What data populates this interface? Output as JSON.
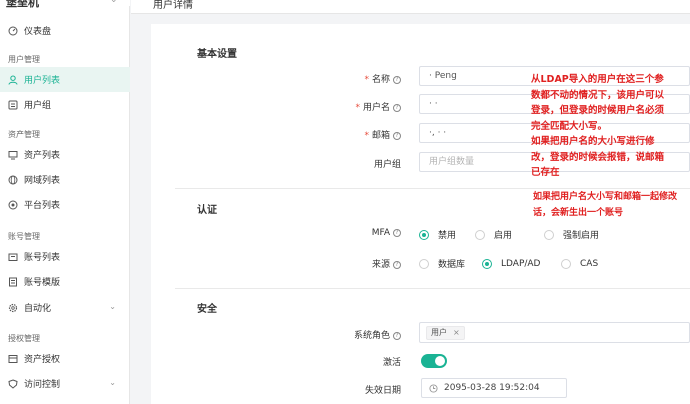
{
  "app": {
    "brand": "堡垒机",
    "page_title": "用户详情"
  },
  "sidebar": {
    "top_item": "仪表盘",
    "groups": [
      {
        "label": "用户管理",
        "items": [
          "用户列表",
          "用户组"
        ]
      },
      {
        "label": "资产管理",
        "items": [
          "资产列表",
          "网域列表",
          "平台列表"
        ]
      },
      {
        "label": "账号管理",
        "items": [
          "账号列表",
          "账号模版",
          "自动化"
        ]
      },
      {
        "label": "授权管理",
        "items": [
          "资产授权",
          "访问控制"
        ]
      }
    ],
    "active_item": "用户列表"
  },
  "form": {
    "basic": {
      "title": "基本设置",
      "name_label": "名称",
      "name_value": "· Peng",
      "username_label": "用户名",
      "username_value": "· ·",
      "email_label": "邮箱",
      "email_value": "·, ·    ·",
      "group_label": "用户组",
      "group_placeholder": "用户组数量"
    },
    "auth": {
      "title": "认证",
      "mfa_label": "MFA",
      "mfa_options": [
        "禁用",
        "启用",
        "强制启用"
      ],
      "mfa_selected": "禁用",
      "source_label": "来源",
      "source_options": [
        "数据库",
        "LDAP/AD",
        "CAS"
      ],
      "source_selected": "LDAP/AD"
    },
    "security": {
      "title": "安全",
      "role_label": "系统角色",
      "role_tag": "用户",
      "active_label": "激活",
      "active_on": true,
      "expire_label": "失效日期",
      "expire_value": "2095-03-28 19:52:04"
    }
  },
  "annotation": {
    "lines": [
      "从LDAP导入的用户在这三个参",
      "数都不动的情况下，该用户可以",
      "登录，但登录的时候用户名必须",
      "完全匹配大小写。",
      "如果把用户名的大小写进行修",
      "改，登录的时候会报错，说邮箱",
      "已存在"
    ],
    "lines2": [
      "如果把用户名大小写和邮箱一起修改",
      "话，会新生出一个账号"
    ],
    "color": "#e02020"
  }
}
